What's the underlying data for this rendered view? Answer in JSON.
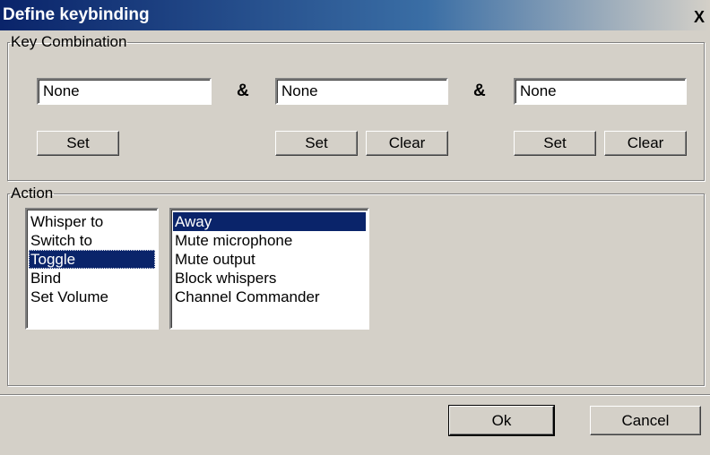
{
  "window": {
    "title": "Define keybinding",
    "close_label": "X"
  },
  "key_combination": {
    "legend": "Key Combination",
    "separator": "&",
    "slots": [
      {
        "value": "None",
        "set_label": "Set"
      },
      {
        "value": "None",
        "set_label": "Set",
        "clear_label": "Clear"
      },
      {
        "value": "None",
        "set_label": "Set",
        "clear_label": "Clear"
      }
    ]
  },
  "action": {
    "legend": "Action",
    "types": [
      "Whisper to",
      "Switch to",
      "Toggle",
      "Bind",
      "Set Volume"
    ],
    "selected_type": "Toggle",
    "targets": [
      "Away",
      "Mute microphone",
      "Mute output",
      "Block whispers",
      "Channel Commander"
    ],
    "selected_target": "Away"
  },
  "footer": {
    "ok_label": "Ok",
    "cancel_label": "Cancel"
  },
  "colors": {
    "selection": "#0a246a",
    "face": "#d4d0c8"
  }
}
